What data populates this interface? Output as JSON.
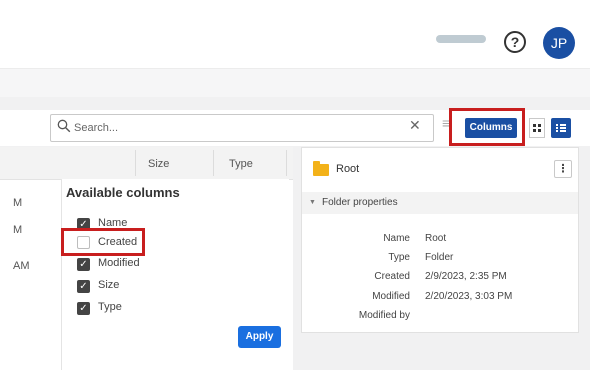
{
  "header": {
    "help_glyph": "?",
    "avatar_initials": "JP"
  },
  "toolbar": {
    "search_placeholder": "Search...",
    "clear_glyph": "✕",
    "filter_glyph": "≡",
    "columns_label": "Columns"
  },
  "table": {
    "headers": [
      "Size",
      "Type"
    ],
    "row_fragments": [
      "M",
      "M",
      "AM"
    ]
  },
  "columns_dropdown": {
    "title": "Available columns",
    "items": [
      {
        "label": "Name",
        "checked": true
      },
      {
        "label": "Created",
        "checked": false
      },
      {
        "label": "Modified",
        "checked": true
      },
      {
        "label": "Size",
        "checked": true
      },
      {
        "label": "Type",
        "checked": true
      }
    ],
    "apply_label": "Apply"
  },
  "details_panel": {
    "folder_name": "Root",
    "more_glyph": "⋮",
    "section_title": "Folder properties",
    "properties": [
      {
        "key": "Name",
        "value": "Root"
      },
      {
        "key": "Type",
        "value": "Folder"
      },
      {
        "key": "Created",
        "value": "2/9/2023, 2:35 PM"
      },
      {
        "key": "Modified",
        "value": "2/20/2023, 3:03 PM"
      },
      {
        "key": "Modified by",
        "value": ""
      }
    ]
  },
  "colors": {
    "primary": "#1a4fa3",
    "apply": "#1a6fe0",
    "highlight": "#c81e1e",
    "folder": "#f3b219"
  }
}
